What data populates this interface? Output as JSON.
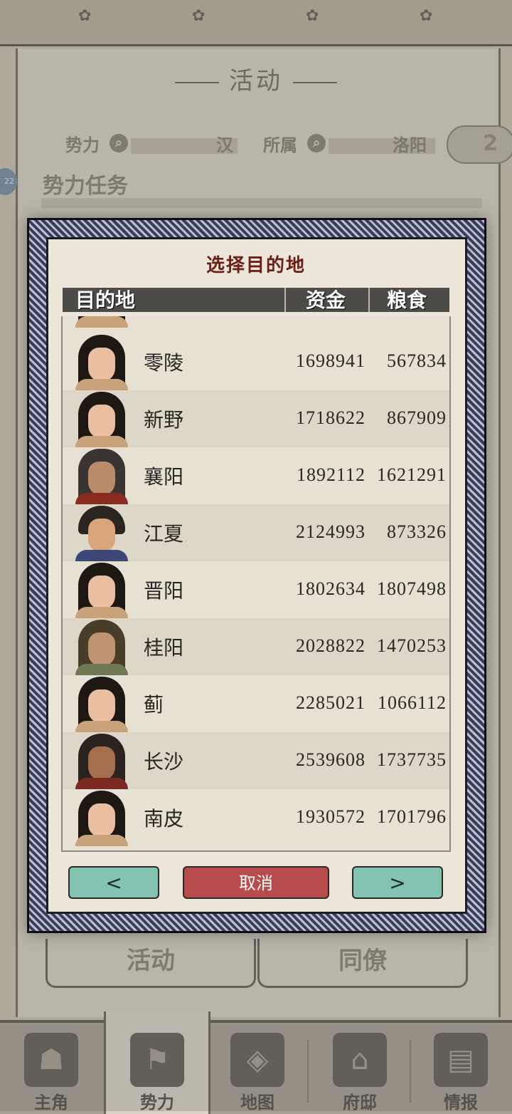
{
  "background": {
    "title": "活动",
    "filters": [
      {
        "label": "势力",
        "value": "汉"
      },
      {
        "label": "所属",
        "value": "洛阳"
      }
    ],
    "badge": "2",
    "side_badge": "22",
    "section": "势力任务",
    "tabs": [
      "活动",
      "同僚"
    ]
  },
  "bottom_nav": [
    {
      "label": "主角",
      "icon": "hero-icon",
      "glyph": "☗"
    },
    {
      "label": "势力",
      "icon": "flag-icon",
      "glyph": "⚑"
    },
    {
      "label": "地图",
      "icon": "map-icon",
      "glyph": "◈"
    },
    {
      "label": "府邸",
      "icon": "mansion-icon",
      "glyph": "⌂"
    },
    {
      "label": "情报",
      "icon": "scroll-icon",
      "glyph": "▤"
    }
  ],
  "dialog": {
    "title": "选择目的地",
    "columns": {
      "destination": "目的地",
      "funds": "资金",
      "grain": "粮食"
    },
    "rows": [
      {
        "city": "零陵",
        "funds": "1698941",
        "grain": "567834",
        "portrait": "female"
      },
      {
        "city": "新野",
        "funds": "1718622",
        "grain": "867909",
        "portrait": "female"
      },
      {
        "city": "襄阳",
        "funds": "1892112",
        "grain": "1621291",
        "portrait": "helm"
      },
      {
        "city": "江夏",
        "funds": "2124993",
        "grain": "873326",
        "portrait": "blue"
      },
      {
        "city": "晋阳",
        "funds": "1802634",
        "grain": "1807498",
        "portrait": "female"
      },
      {
        "city": "桂阳",
        "funds": "2028822",
        "grain": "1470253",
        "portrait": "crown"
      },
      {
        "city": "蓟",
        "funds": "2285021",
        "grain": "1066112",
        "portrait": "female"
      },
      {
        "city": "长沙",
        "funds": "2539608",
        "grain": "1737735",
        "portrait": "dark"
      },
      {
        "city": "南皮",
        "funds": "1930572",
        "grain": "1701796",
        "portrait": "female"
      }
    ],
    "prev_label": "<",
    "cancel_label": "取消",
    "next_label": ">"
  }
}
